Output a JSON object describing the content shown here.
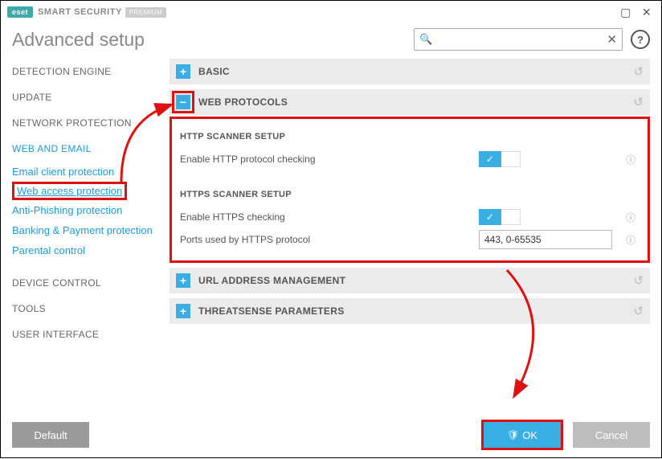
{
  "brand": {
    "badge": "eset",
    "name": "SMART SECURITY",
    "edition": "PREMIUM"
  },
  "page_title": "Advanced setup",
  "search": {
    "value": ""
  },
  "sidebar": {
    "primary": [
      "DETECTION ENGINE",
      "UPDATE",
      "NETWORK PROTECTION",
      "WEB AND EMAIL"
    ],
    "sub": [
      "Email client protection",
      "Web access protection",
      "Anti-Phishing protection",
      "Banking & Payment protection",
      "Parental control"
    ],
    "primary2": [
      "DEVICE CONTROL",
      "TOOLS",
      "USER INTERFACE"
    ]
  },
  "sections": {
    "basic": {
      "title": "BASIC"
    },
    "web_protocols": {
      "title": "WEB PROTOCOLS",
      "http": {
        "group": "HTTP SCANNER SETUP",
        "enable_label": "Enable HTTP protocol checking"
      },
      "https": {
        "group": "HTTPS SCANNER SETUP",
        "enable_label": "Enable HTTPS checking",
        "ports_label": "Ports used by HTTPS protocol",
        "ports_value": "443, 0-65535"
      }
    },
    "url_mgmt": {
      "title": "URL ADDRESS MANAGEMENT"
    },
    "threatsense": {
      "title": "THREATSENSE PARAMETERS"
    }
  },
  "footer": {
    "default": "Default",
    "ok": "OK",
    "cancel": "Cancel"
  }
}
